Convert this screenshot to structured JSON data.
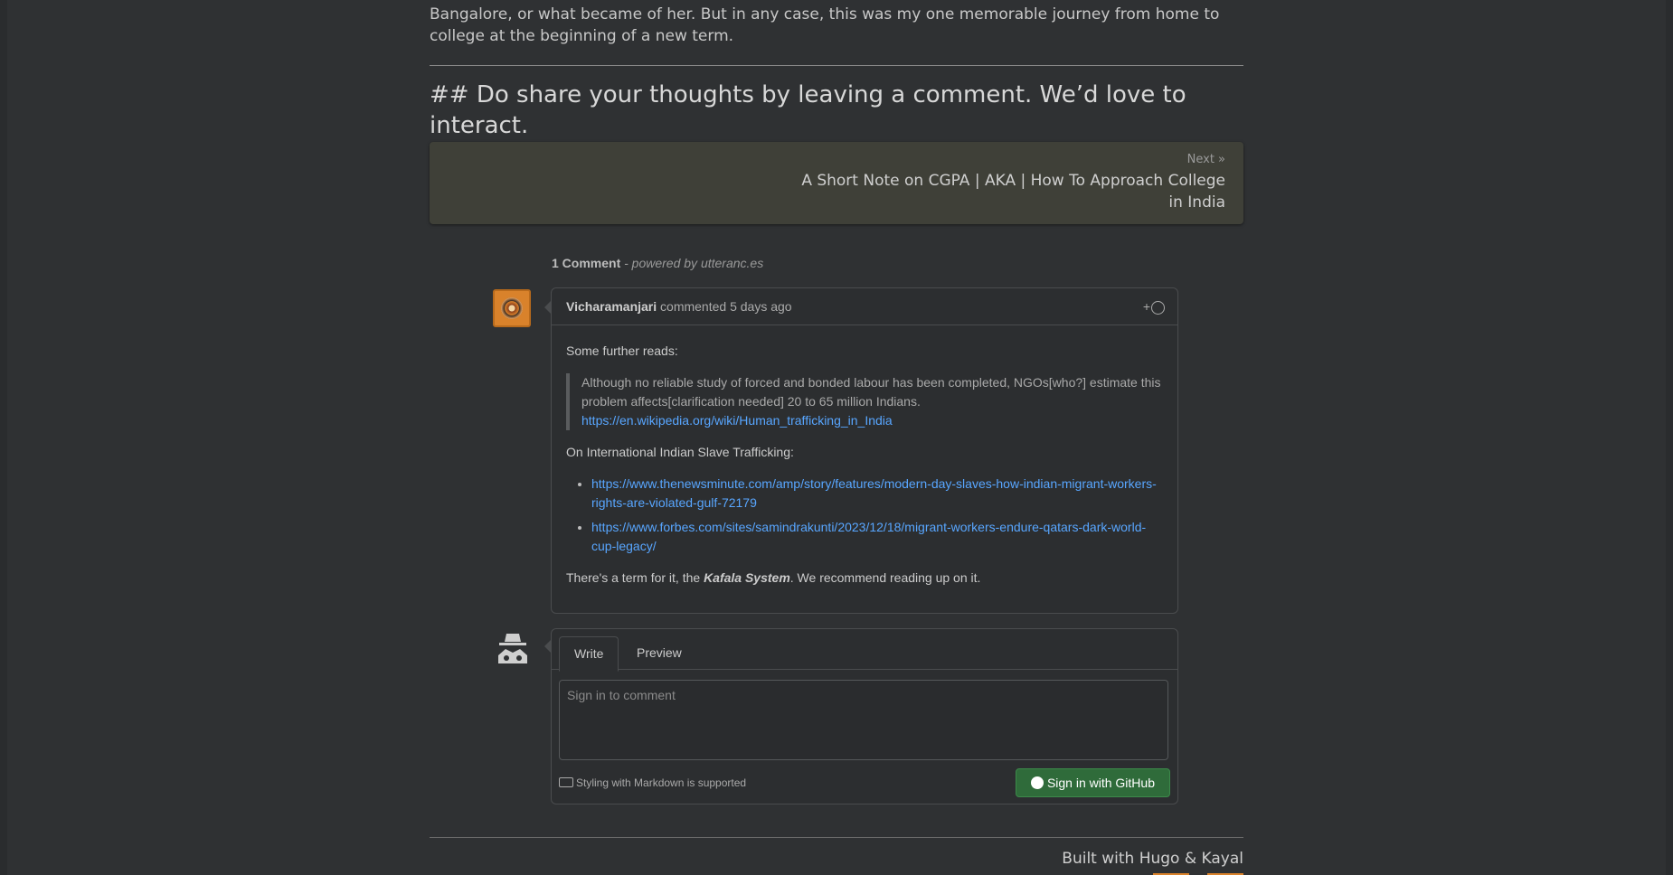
{
  "article": {
    "paragraph_tail": "Bangalore, or what became of her. But in any case, this was my one memorable journey from home to college at the beginning of a new term.",
    "heading": "## Do share your thoughts by leaving a comment. We’d love to interact.",
    "next_label": "Next »",
    "next_title": "A Short Note on CGPA | AKA | How To Approach College in India"
  },
  "comments": {
    "count_label": "1 Comment",
    "powered_by": "- powered by utteranc.es",
    "comment": {
      "author": "Vicharamanjari",
      "meta": "commented 5 days ago",
      "reaction_label": "+",
      "intro": "Some further reads:",
      "quote_text": "Although no reliable study of forced and bonded labour has been completed, NGOs[who?] estimate this problem affects[clarification needed] 20 to 65 million Indians.",
      "quote_link": "https://en.wikipedia.org/wiki/Human_trafficking_in_India",
      "section_label": "On International Indian Slave Trafficking:",
      "links": [
        "https://www.thenewsminute.com/amp/story/features/modern-day-slaves-how-indian-migrant-workers-rights-are-violated-gulf-72179",
        "https://www.forbes.com/sites/samindrakunti/2023/12/18/migrant-workers-endure-qatars-dark-world-cup-legacy/"
      ],
      "closing_prefix": "There's a term for it, the ",
      "closing_emph": "Kafala System",
      "closing_suffix": ". We recommend reading up on it."
    },
    "editor": {
      "tab_write": "Write",
      "tab_preview": "Preview",
      "placeholder": "Sign in to comment",
      "markdown_note": "Styling with Markdown is supported",
      "signin_label": "Sign in with GitHub"
    }
  },
  "footer": {
    "text": "Built with Hugo & Kayal"
  },
  "colors": {
    "background": "#2f3133",
    "link": "#58a6ff",
    "accent": "#d9822b",
    "signin_button": "#2f6b3a"
  }
}
